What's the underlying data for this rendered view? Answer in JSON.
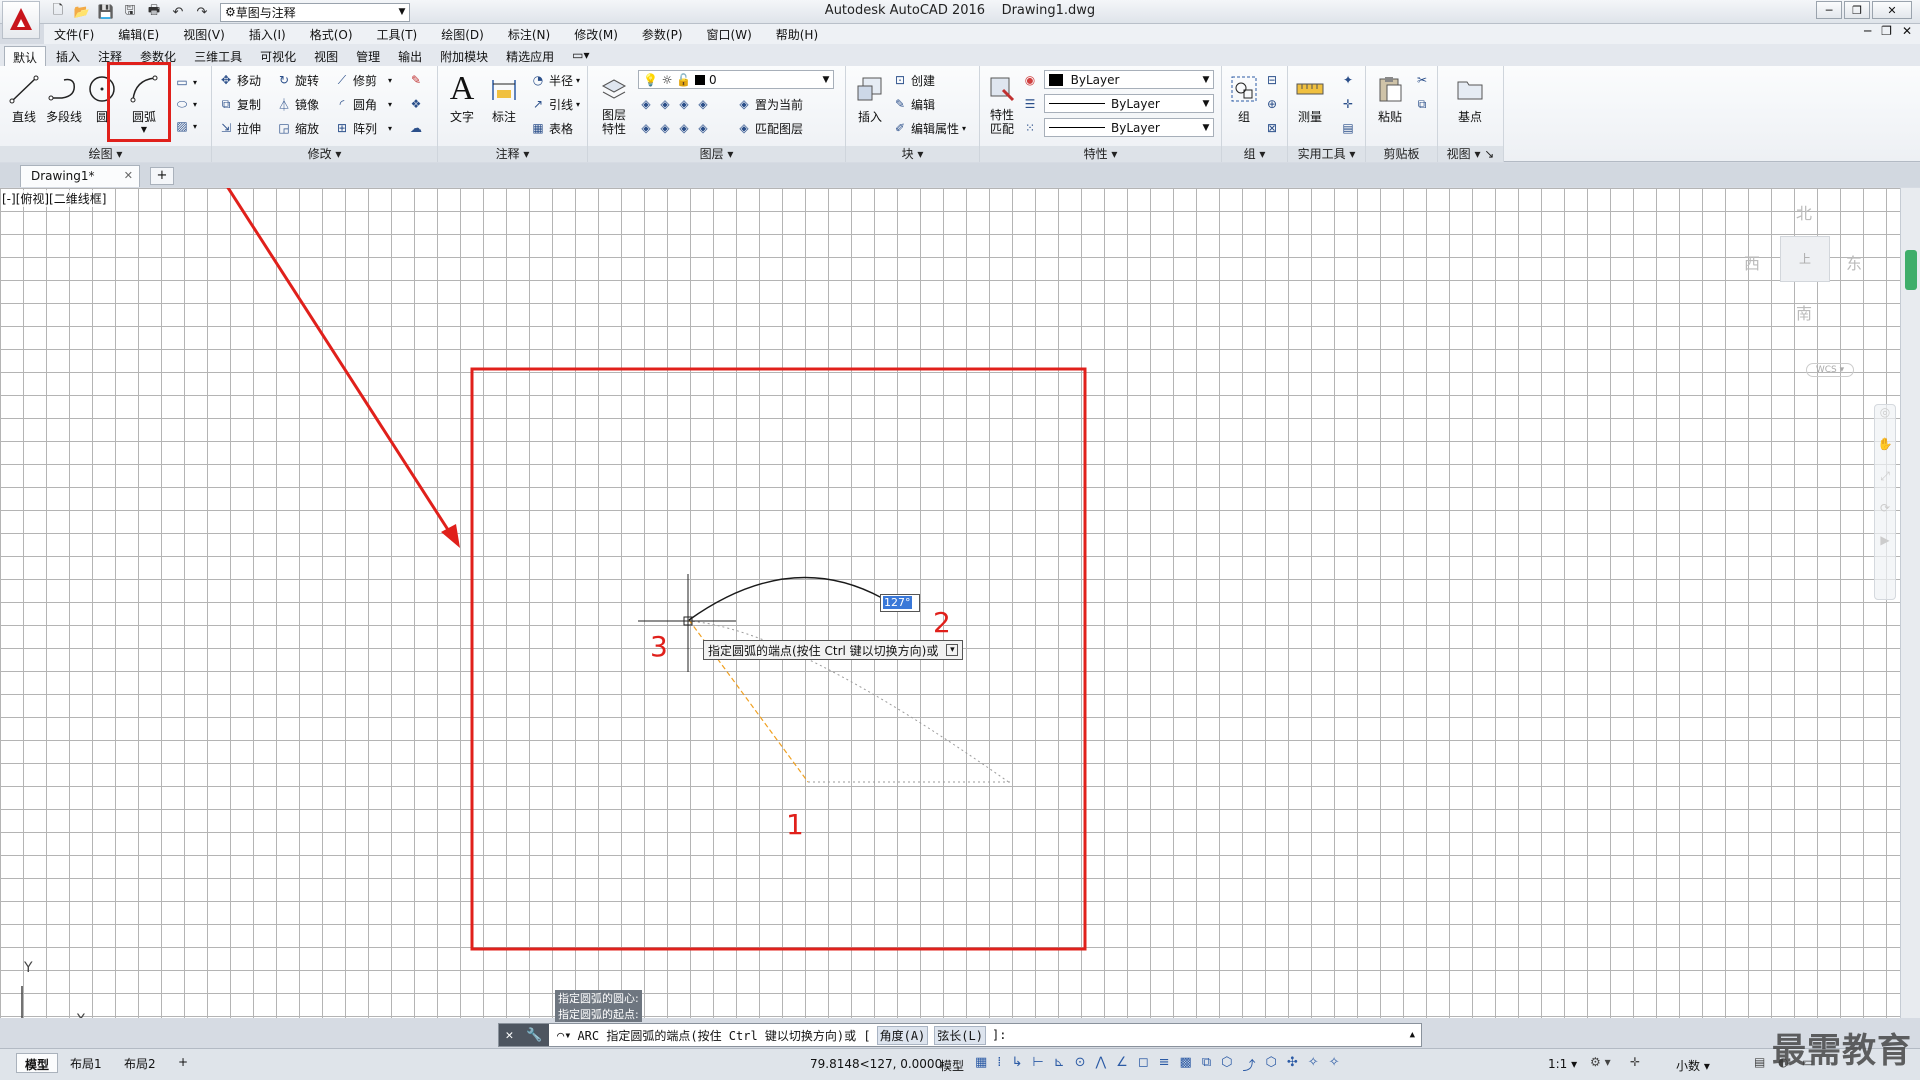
{
  "title": {
    "app": "Autodesk AutoCAD 2016",
    "file": "Drawing1.dwg"
  },
  "quick_access": {
    "workspace": "草图与注释"
  },
  "menu": [
    "文件(F)",
    "编辑(E)",
    "视图(V)",
    "插入(I)",
    "格式(O)",
    "工具(T)",
    "绘图(D)",
    "标注(N)",
    "修改(M)",
    "参数(P)",
    "窗口(W)",
    "帮助(H)"
  ],
  "ribbon_tabs": [
    "默认",
    "插入",
    "注释",
    "参数化",
    "三维工具",
    "可视化",
    "视图",
    "管理",
    "输出",
    "附加模块",
    "精选应用"
  ],
  "ribbon": {
    "draw": {
      "title": "绘图",
      "line": "直线",
      "polyline": "多段线",
      "circle": "圆",
      "arc": "圆弧"
    },
    "modify": {
      "title": "修改",
      "move": "移动",
      "rotate": "旋转",
      "trim": "修剪",
      "copy": "复制",
      "mirror": "镜像",
      "fillet": "圆角",
      "stretch": "拉伸",
      "scale": "缩放",
      "array": "阵列"
    },
    "annotation": {
      "title": "注释",
      "text": "文字",
      "dimension": "标注",
      "radius": "半径",
      "leader": "引线",
      "table": "表格"
    },
    "layers": {
      "title": "图层",
      "layer_props": "图层\n特性",
      "layer_props_l1": "图层",
      "layer_props_l2": "特性",
      "current_layer": "0",
      "make_current": "置为当前",
      "match_layer": "匹配图层"
    },
    "block": {
      "title": "块",
      "insert": "插入",
      "create": "创建",
      "edit": "编辑",
      "edit_attr": "编辑属性"
    },
    "properties": {
      "title": "特性",
      "match_l1": "特性",
      "match_l2": "匹配",
      "color": "ByLayer",
      "linetype": "ByLayer",
      "lineweight": "ByLayer"
    },
    "groups": {
      "title": "组",
      "group": "组"
    },
    "utilities": {
      "title": "实用工具",
      "measure": "测量"
    },
    "clipboard": {
      "title": "剪贴板",
      "paste": "粘贴"
    },
    "view": {
      "title": "视图",
      "base": "基点"
    }
  },
  "doc_tab": {
    "name": "Drawing1*"
  },
  "viewport": {
    "label": "[-][俯视][二维线框]"
  },
  "viewcube": {
    "north": "北",
    "south": "南",
    "east": "东",
    "west": "西",
    "top": "上",
    "wcs": "WCS"
  },
  "drawing": {
    "angle_input": "127°",
    "tooltip": "指定圆弧的端点(按住 Ctrl 键以切换方向)或",
    "markers": {
      "m1": "1",
      "m2": "2",
      "m3": "3"
    },
    "ucs_y": "Y",
    "ucs_x": "X"
  },
  "command": {
    "history": [
      "指定圆弧的圆心:",
      "指定圆弧的起点:"
    ],
    "prompt_prefix": "ARC 指定圆弧的端点(按住 Ctrl 键以切换方向)或 [",
    "opt_angle": "角度(A)",
    "opt_chord": "弦长(L)",
    "prompt_suffix": "]:"
  },
  "status": {
    "layouts": [
      "模型",
      "布局1",
      "布局2"
    ],
    "coords": "79.8148<127, 0.0000",
    "space": "模型",
    "scale": "1:1",
    "units": "小数"
  },
  "watermark": "最需教育",
  "colors": {
    "highlight_red": "#e0201b",
    "arc_dark": "#1a1a1a",
    "guide_orange": "#f0a020",
    "grid": "#b4b4b4"
  }
}
